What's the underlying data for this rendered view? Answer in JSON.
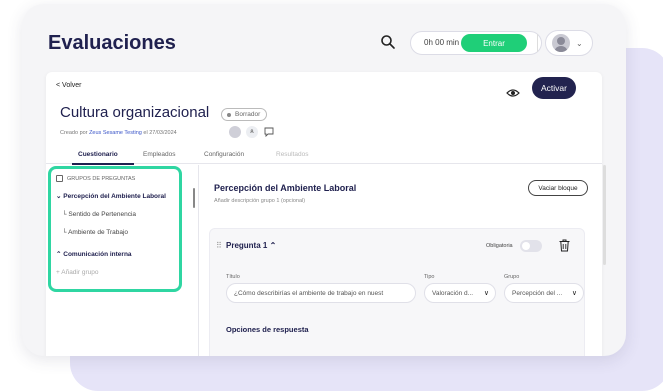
{
  "app": {
    "title": "Evaluaciones"
  },
  "header": {
    "timer": "0h 00 min",
    "entrar_label": "Entrar"
  },
  "page": {
    "back_label": "< Volver",
    "activar_label": "Activar",
    "title": "Cultura organizacional",
    "status": "Borrador",
    "created_prefix": "Creado por",
    "created_user": "Zeus Sesame Testing",
    "created_date": "el 27/03/2024"
  },
  "tabs": [
    {
      "label": "Cuestionario",
      "active": true
    },
    {
      "label": "Empleados"
    },
    {
      "label": "Configuración"
    },
    {
      "label": "Resultados",
      "disabled": true
    }
  ],
  "sidebar": {
    "header": "GRUPOS DE PREGUNTAS",
    "items": [
      {
        "label": "Percepción del Ambiente Laboral"
      },
      {
        "label": "Sentido de Pertenencia"
      },
      {
        "label": "Ambiente de Trabajo"
      },
      {
        "label": "Comunicación interna"
      },
      {
        "label": "+ Añadir grupo"
      }
    ],
    "highlight_color": "#2fd6a2"
  },
  "main": {
    "block_title": "Percepción del Ambiente Laboral",
    "block_desc": "Añadir descripción grupo 1 (opcional)",
    "vaciar_label": "Vaciar bloque",
    "question": {
      "title": "Pregunta 1",
      "oblig_label": "Obligatoria",
      "titulo_label": "Título",
      "titulo_value": "¿Cómo describirías el ambiente de trabajo en nuest",
      "tipo_label": "Tipo",
      "tipo_value": "Valoración d...",
      "grupo_label": "Grupo",
      "grupo_value": "Percepción del ...",
      "opciones_label": "Opciones de respuesta"
    }
  },
  "colors": {
    "brand_dark": "#20214f",
    "entrar_green": "#1fcf78",
    "highlight": "#2fd6a2",
    "backdrop": "#e6e4f8"
  }
}
